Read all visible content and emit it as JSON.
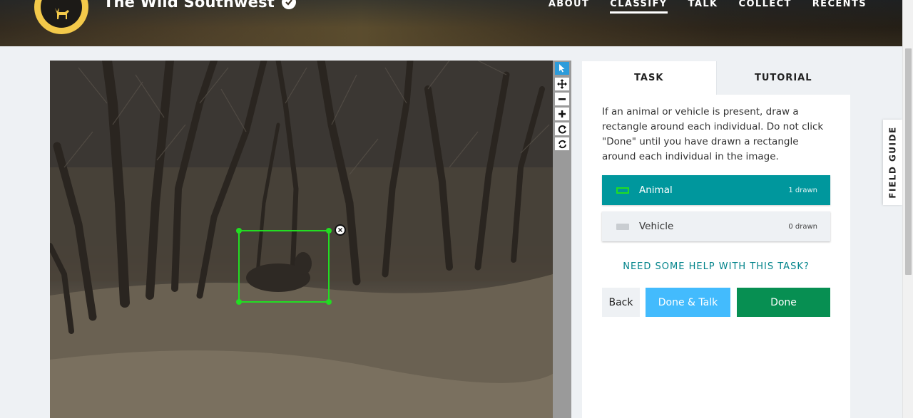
{
  "header": {
    "project_title": "The Wild Southwest",
    "nav": [
      "ABOUT",
      "CLASSIFY",
      "TALK",
      "COLLECT",
      "RECENTS"
    ],
    "active_nav": "CLASSIFY"
  },
  "viewer_tools": [
    "pointer-icon",
    "move-icon",
    "zoom-out-icon",
    "zoom-in-icon",
    "rotate-icon",
    "reset-icon"
  ],
  "annotation": {
    "delete_mark": "×"
  },
  "task_panel": {
    "tabs": {
      "task": "TASK",
      "tutorial": "TUTORIAL"
    },
    "instructions": "If an animal or vehicle is present, draw a rectangle around each individual. Do not click \"Done\" until you have drawn a rectangle around each individual in the image.",
    "tools": [
      {
        "label": "Animal",
        "count": "1 drawn",
        "color": "#22dd22"
      },
      {
        "label": "Vehicle",
        "count": "0 drawn",
        "color": "#c9cdd1"
      }
    ],
    "help_link": "NEED SOME HELP WITH THIS TASK?",
    "buttons": {
      "back": "Back",
      "done_talk": "Done & Talk",
      "done": "Done"
    }
  },
  "field_guide": "FIELD GUIDE",
  "colors": {
    "accent_teal": "#00979d",
    "done_green": "#078f52",
    "done_talk_blue": "#43bbfd",
    "logo_gold": "#f3c94a"
  }
}
